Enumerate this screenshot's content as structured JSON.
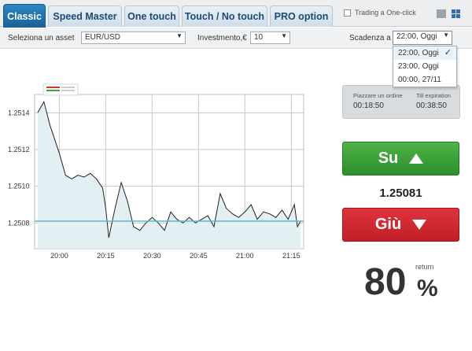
{
  "tabs": [
    {
      "label": "Classic",
      "active": true
    },
    {
      "label": "Speed Master",
      "active": false
    },
    {
      "label": "One touch",
      "active": false
    },
    {
      "label": "Touch / No touch",
      "active": false
    },
    {
      "label": "PRO option",
      "active": false
    }
  ],
  "one_click": {
    "label": "Trading a One-click",
    "checked": false
  },
  "view_toggle": {
    "icons": [
      "single-view-icon",
      "grid-view-icon"
    ]
  },
  "options_bar": {
    "asset_label": "Seleziona un asset",
    "asset_value": "EUR/USD",
    "investment_label": "Investmento,€",
    "investment_value": "10",
    "expiry_label": "Scadenza a",
    "expiry_value": "22:00, Oggi"
  },
  "expiry_options": [
    {
      "label": "22:00, Oggi",
      "selected": true
    },
    {
      "label": "23:00, Oggi",
      "selected": false
    },
    {
      "label": "00:00, 27/11",
      "selected": false
    }
  ],
  "timer": {
    "place_label": "Piazzare un ordine",
    "place_value": "00:18:50",
    "expiry_label": "Till expiration",
    "expiry_value": "00:38:50"
  },
  "actions": {
    "up_label": "Su",
    "down_label": "Giù"
  },
  "current_price": "1.25081",
  "return": {
    "label": "return",
    "value": "80",
    "unit": "%"
  },
  "colors": {
    "accent": "#1a5f97",
    "up": "#2c8f2a",
    "down": "#c01f27",
    "line": "#5fb8c2"
  },
  "chart_data": {
    "type": "area",
    "xlabel": "",
    "ylabel": "",
    "x_ticks": [
      "20:00",
      "20:15",
      "20:30",
      "20:45",
      "21:00",
      "21:15"
    ],
    "y_ticks": [
      "1.2514",
      "1.2512",
      "1.2510",
      "1.2508"
    ],
    "ylim": [
      1.25066,
      1.2515
    ],
    "current_level": 1.25081,
    "grid": true,
    "series": [
      {
        "x": [
          "19:53",
          "19:55",
          "19:57",
          "19:58",
          "20:00",
          "20:02",
          "20:04",
          "20:06",
          "20:08",
          "20:10",
          "20:12",
          "20:14",
          "20:15",
          "20:16",
          "20:18",
          "20:20",
          "20:22",
          "20:24",
          "20:26",
          "20:28",
          "20:30",
          "20:32",
          "20:34",
          "20:36",
          "20:38",
          "20:40",
          "20:42",
          "20:44",
          "20:46",
          "20:48",
          "20:50",
          "20:52",
          "20:54",
          "20:56",
          "20:58",
          "21:00",
          "21:02",
          "21:04",
          "21:06",
          "21:08",
          "21:10",
          "21:12",
          "21:14",
          "21:16",
          "21:17",
          "21:18"
        ],
        "y": [
          1.2514,
          1.25146,
          1.25133,
          1.25128,
          1.25118,
          1.25106,
          1.25104,
          1.25106,
          1.25105,
          1.25107,
          1.25104,
          1.25099,
          1.25088,
          1.25072,
          1.25088,
          1.25102,
          1.25092,
          1.25078,
          1.25076,
          1.2508,
          1.25083,
          1.2508,
          1.25076,
          1.25086,
          1.25082,
          1.2508,
          1.25083,
          1.2508,
          1.25082,
          1.25084,
          1.25078,
          1.25096,
          1.25088,
          1.25085,
          1.25083,
          1.25086,
          1.2509,
          1.25082,
          1.25086,
          1.25085,
          1.25083,
          1.25087,
          1.25082,
          1.2509,
          1.25078,
          1.25081
        ]
      }
    ]
  }
}
